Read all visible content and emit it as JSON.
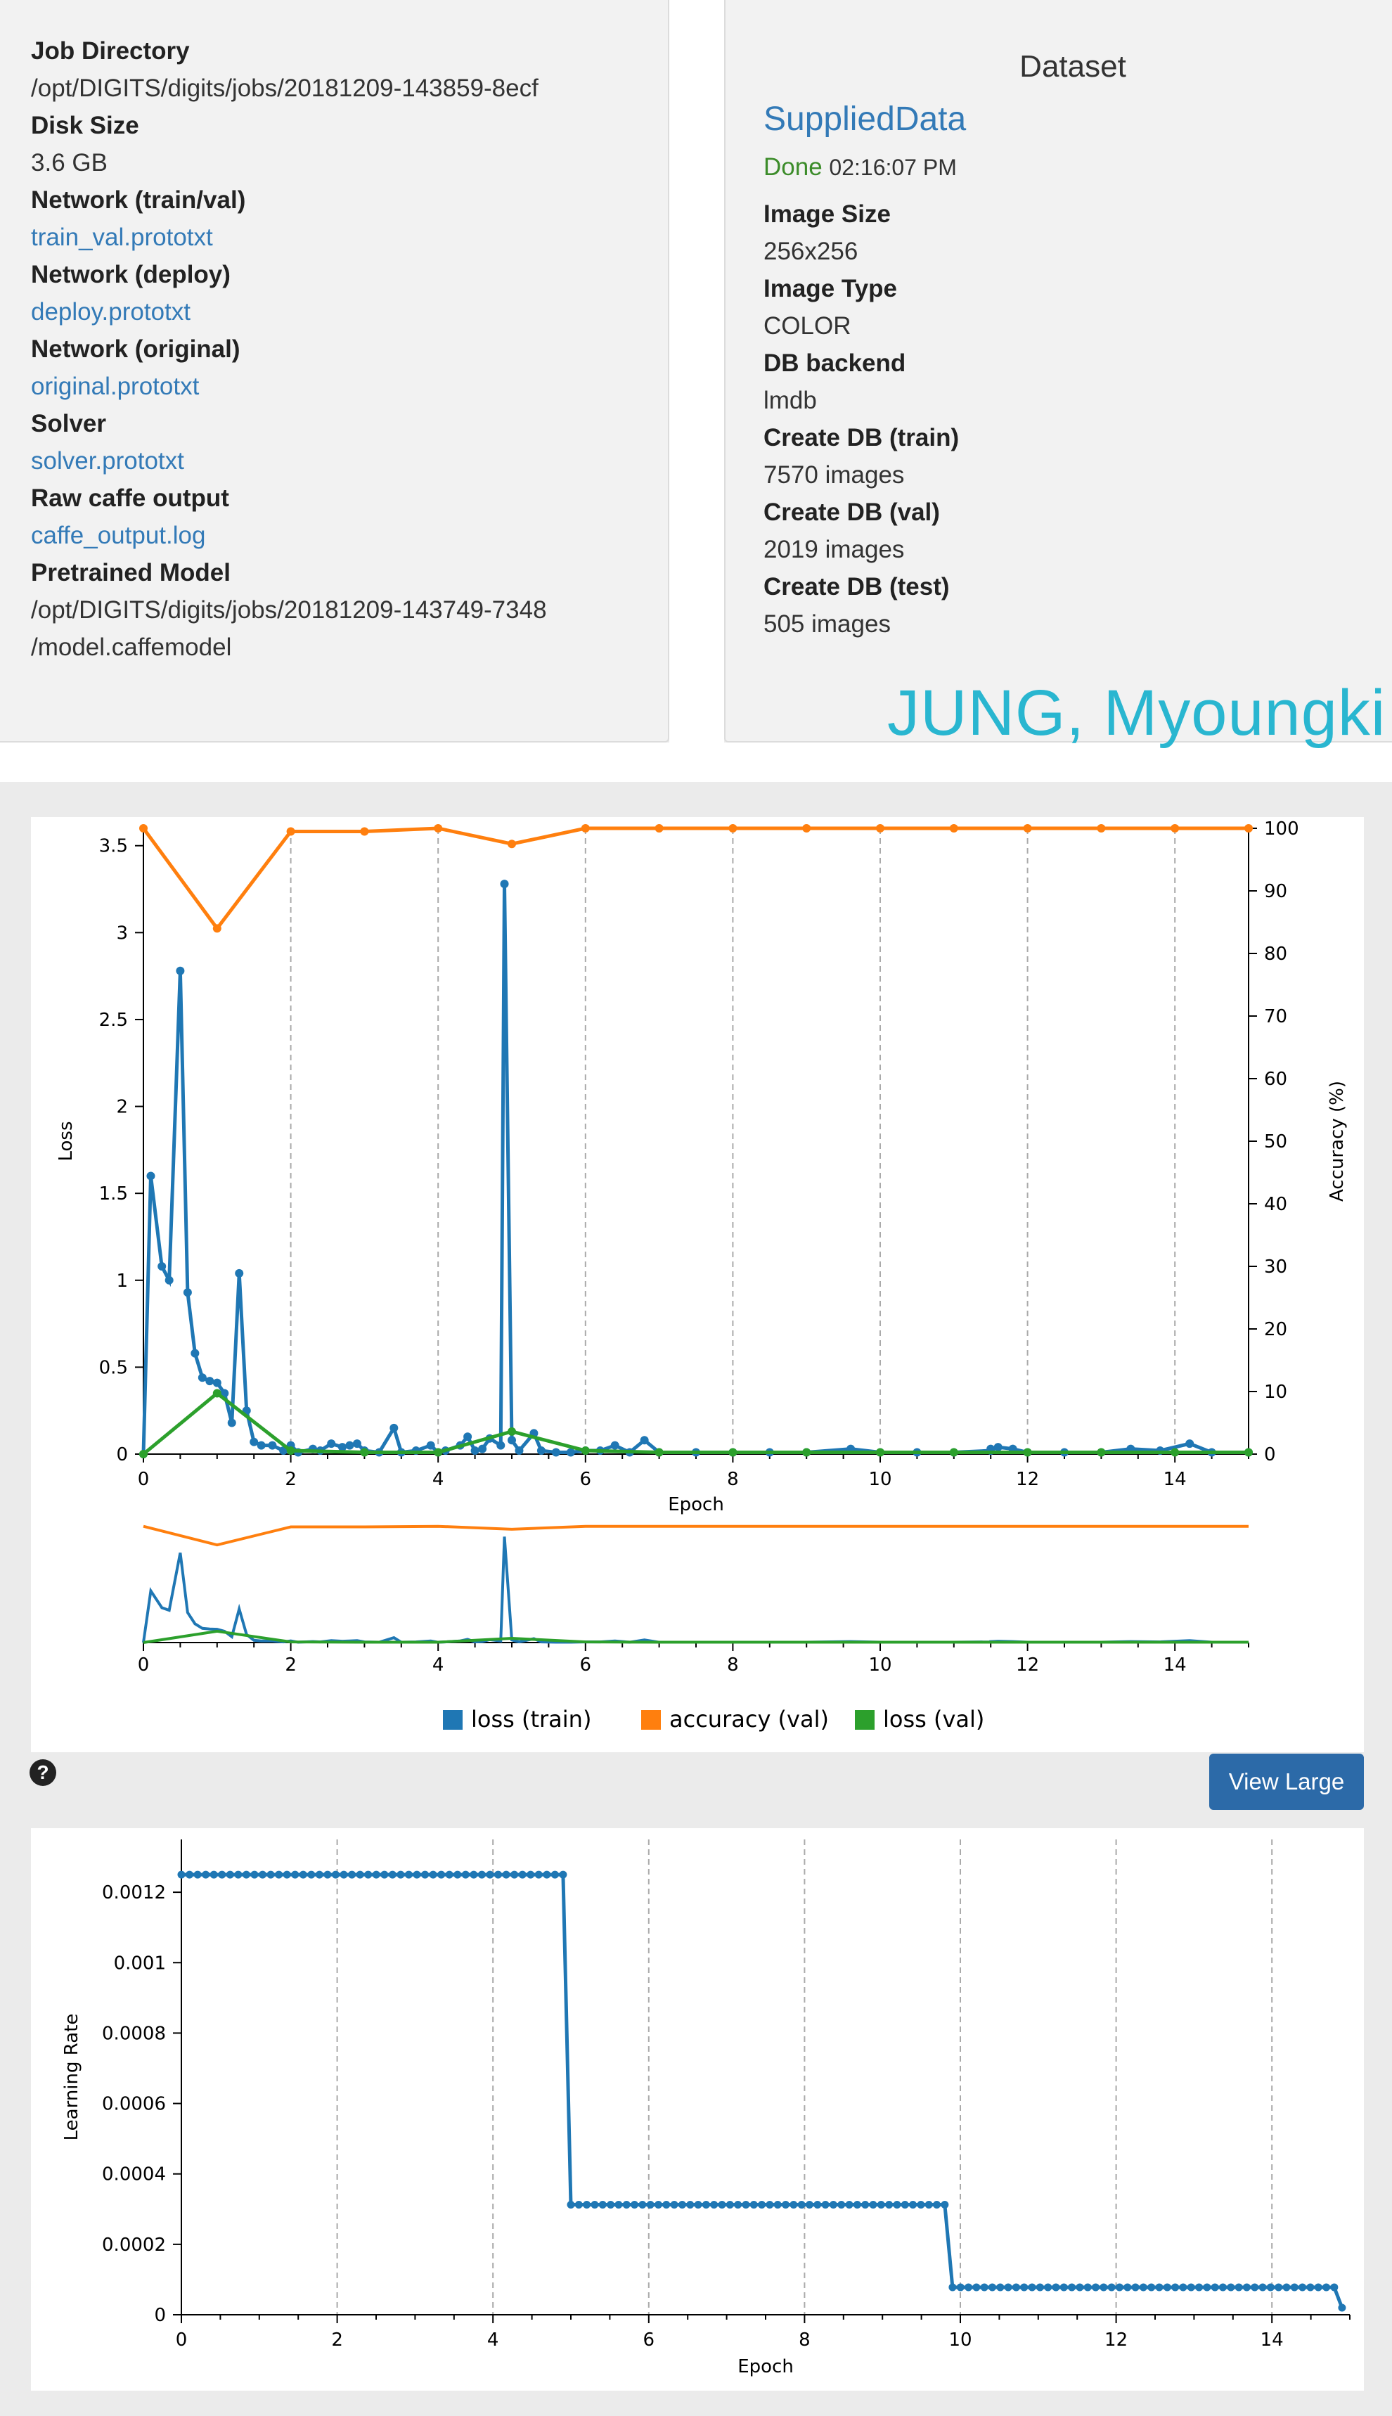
{
  "job_info": [
    {
      "label": "Job Directory",
      "value": "/opt/DIGITS/digits/jobs/20181209-143859-8ecf",
      "link": false
    },
    {
      "label": "Disk Size",
      "value": "3.6 GB",
      "link": false
    },
    {
      "label": "Network (train/val)",
      "value": "train_val.prototxt",
      "link": true
    },
    {
      "label": "Network (deploy)",
      "value": "deploy.prototxt",
      "link": true
    },
    {
      "label": "Network (original)",
      "value": "original.prototxt",
      "link": true
    },
    {
      "label": "Solver",
      "value": "solver.prototxt",
      "link": true
    },
    {
      "label": "Raw caffe output",
      "value": "caffe_output.log",
      "link": true
    },
    {
      "label": "Pretrained Model",
      "value": "/opt/DIGITS/digits/jobs/20181209-143749-7348",
      "value2": "/model.caffemodel",
      "link": false
    }
  ],
  "dataset": {
    "heading": "Dataset",
    "name": "SuppliedData",
    "status": "Done",
    "time": "02:16:07 PM",
    "items": [
      {
        "label": "Image Size",
        "value": "256x256"
      },
      {
        "label": "Image Type",
        "value": "COLOR"
      },
      {
        "label": "DB backend",
        "value": "lmdb"
      },
      {
        "label": "Create DB (train)",
        "value": "7570 images"
      },
      {
        "label": "Create DB (val)",
        "value": "2019 images"
      },
      {
        "label": "Create DB (test)",
        "value": "505 images"
      }
    ]
  },
  "watermark": "JUNG, Myoungki",
  "help_icon": "question-circle-icon",
  "view_large_label": "View Large",
  "colors": {
    "train_loss": "#1f77b4",
    "val_accuracy": "#ff7f0e",
    "val_loss": "#2ca02c",
    "button": "#2c6aa8",
    "link": "#337ab7",
    "watermark": "#29b6d0"
  },
  "chart_data": [
    {
      "type": "line",
      "xlabel": "Epoch",
      "ylabel": "Loss",
      "y2label": "Accuracy (%)",
      "xlim": [
        0,
        15
      ],
      "ylim": [
        0,
        3.6
      ],
      "y2lim": [
        0,
        100
      ],
      "x_ticks": [
        0,
        2,
        4,
        6,
        8,
        10,
        12,
        14
      ],
      "y_ticks": [
        0,
        0.5,
        1,
        1.5,
        2,
        2.5,
        3,
        3.5
      ],
      "y2_ticks": [
        0,
        10,
        20,
        30,
        40,
        50,
        60,
        70,
        80,
        90,
        100
      ],
      "grid": "vertical dashed",
      "legend_position": "bottom",
      "series": [
        {
          "name": "loss (train)",
          "axis": "left",
          "x": [
            0,
            0.1,
            0.25,
            0.35,
            0.5,
            0.6,
            0.7,
            0.8,
            0.9,
            1.0,
            1.1,
            1.2,
            1.3,
            1.4,
            1.5,
            1.6,
            1.75,
            1.9,
            2.0,
            2.1,
            2.3,
            2.4,
            2.55,
            2.7,
            2.8,
            2.9,
            3.0,
            3.2,
            3.4,
            3.5,
            3.7,
            3.9,
            4.0,
            4.1,
            4.3,
            4.4,
            4.5,
            4.6,
            4.7,
            4.85,
            4.9,
            5.0,
            5.1,
            5.3,
            5.4,
            5.6,
            5.8,
            6.0,
            6.2,
            6.4,
            6.6,
            6.8,
            7.0,
            7.5,
            8.0,
            8.5,
            9.0,
            9.6,
            10.0,
            10.5,
            11.0,
            11.5,
            11.5,
            11.6,
            11.8,
            12.0,
            12.5,
            13.0,
            13.4,
            13.8,
            14.2,
            14.5,
            15.0
          ],
          "y": [
            0,
            1.6,
            1.08,
            1.0,
            2.78,
            0.93,
            0.58,
            0.44,
            0.42,
            0.41,
            0.35,
            0.18,
            1.04,
            0.25,
            0.07,
            0.05,
            0.05,
            0.02,
            0.05,
            0.01,
            0.03,
            0.02,
            0.06,
            0.04,
            0.05,
            0.06,
            0.02,
            0.01,
            0.15,
            0.01,
            0.02,
            0.05,
            0.01,
            0.02,
            0.05,
            0.1,
            0.02,
            0.03,
            0.09,
            0.05,
            3.28,
            0.08,
            0.02,
            0.12,
            0.02,
            0.01,
            0.01,
            0.02,
            0.02,
            0.05,
            0.01,
            0.08,
            0.01,
            0.01,
            0.01,
            0.01,
            0.01,
            0.03,
            0.01,
            0.01,
            0.01,
            0.02,
            0.03,
            0.04,
            0.03,
            0.01,
            0.01,
            0.01,
            0.03,
            0.02,
            0.06,
            0.01,
            0.01
          ]
        },
        {
          "name": "accuracy (val)",
          "axis": "right",
          "x": [
            0,
            1,
            2,
            3,
            4,
            5,
            6,
            7,
            8,
            9,
            10,
            11,
            12,
            13,
            14,
            15
          ],
          "y": [
            100,
            84,
            99.5,
            99.5,
            100,
            97.5,
            100,
            100,
            100,
            100,
            100,
            100,
            100,
            100,
            100,
            100
          ]
        },
        {
          "name": "loss (val)",
          "axis": "left",
          "x": [
            0,
            1,
            2,
            3,
            4,
            5,
            6,
            7,
            8,
            9,
            10,
            11,
            12,
            13,
            14,
            15
          ],
          "y": [
            0,
            0.35,
            0.02,
            0.01,
            0.01,
            0.13,
            0.02,
            0.01,
            0.01,
            0.01,
            0.01,
            0.01,
            0.01,
            0.01,
            0.01,
            0.01
          ]
        }
      ]
    },
    {
      "type": "line",
      "xlabel": "Epoch",
      "ylabel": "Learning Rate",
      "xlim": [
        0,
        15
      ],
      "ylim": [
        0,
        0.00135
      ],
      "x_ticks": [
        0,
        2,
        4,
        6,
        8,
        10,
        12,
        14
      ],
      "y_ticks": [
        0,
        0.0002,
        0.0004,
        0.0006,
        0.0008,
        0.001,
        0.0012
      ],
      "y_tick_labels": [
        "0",
        "0.0002",
        "0.0004",
        "0.0006",
        "0.0008",
        "0.001",
        "0.0012"
      ],
      "grid": "vertical dashed",
      "series": [
        {
          "name": "",
          "segments": [
            {
              "x_start": 0,
              "x_end": 4.9,
              "value": 0.00125,
              "points": 48
            },
            {
              "x_start": 5.0,
              "x_end": 9.8,
              "value": 0.0003125,
              "points": 48
            },
            {
              "x_start": 9.9,
              "x_end": 14.8,
              "value": 7.8e-05,
              "points": 49
            }
          ],
          "last_point": {
            "x": 14.9,
            "y": 2e-05
          }
        }
      ]
    }
  ]
}
